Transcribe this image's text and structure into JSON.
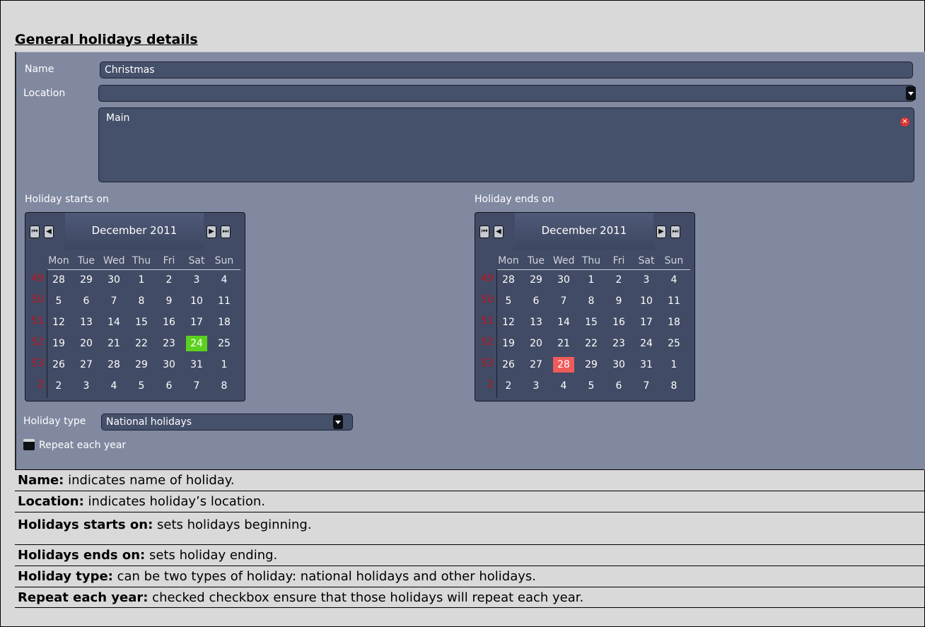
{
  "heading": "General holidays details",
  "form": {
    "name_label": "Name",
    "name_value": "Christmas",
    "location_label": "Location",
    "location_value": "",
    "location_list": [
      "Main"
    ],
    "start_label": "Holiday starts on",
    "end_label": "Holiday ends on",
    "type_label": "Holiday type",
    "type_value": "National holidays",
    "repeat_label": "Repeat each year"
  },
  "calendars": [
    {
      "month": "December 2011",
      "selected_day": "24",
      "selected_row": 3,
      "selected_col": 5,
      "selected_color": "#5bd11f"
    },
    {
      "month": "December 2011",
      "selected_day": "28",
      "selected_row": 4,
      "selected_col": 2,
      "selected_color": "#ef5b5b"
    }
  ],
  "calendar_grid": {
    "days_of_week": [
      "Mon",
      "Tue",
      "Wed",
      "Thu",
      "Fri",
      "Sat",
      "Sun"
    ],
    "week_numbers": [
      "49",
      "50",
      "51",
      "52",
      "53",
      "2"
    ],
    "rows": [
      [
        "28",
        "29",
        "30",
        "1",
        "2",
        "3",
        "4"
      ],
      [
        "5",
        "6",
        "7",
        "8",
        "9",
        "10",
        "11"
      ],
      [
        "12",
        "13",
        "14",
        "15",
        "16",
        "17",
        "18"
      ],
      [
        "19",
        "20",
        "21",
        "22",
        "23",
        "24",
        "25"
      ],
      [
        "26",
        "27",
        "28",
        "29",
        "30",
        "31",
        "1"
      ],
      [
        "2",
        "3",
        "4",
        "5",
        "6",
        "7",
        "8"
      ]
    ]
  },
  "descriptions": [
    {
      "term": "Name:",
      "text": " indicates name of holiday."
    },
    {
      "term": "Location:",
      "text": " indicates holiday’s location."
    },
    {
      "term": "Holidays starts on:",
      "text": " sets holidays beginning."
    },
    {
      "term": "Holidays ends on:",
      "text": " sets holiday ending."
    },
    {
      "term": "Holiday type:",
      "text": " can be two types of holiday: national holidays and other holidays."
    },
    {
      "term": "Repeat each year:",
      "text": " checked checkbox ensure that those holidays will repeat each year."
    }
  ]
}
